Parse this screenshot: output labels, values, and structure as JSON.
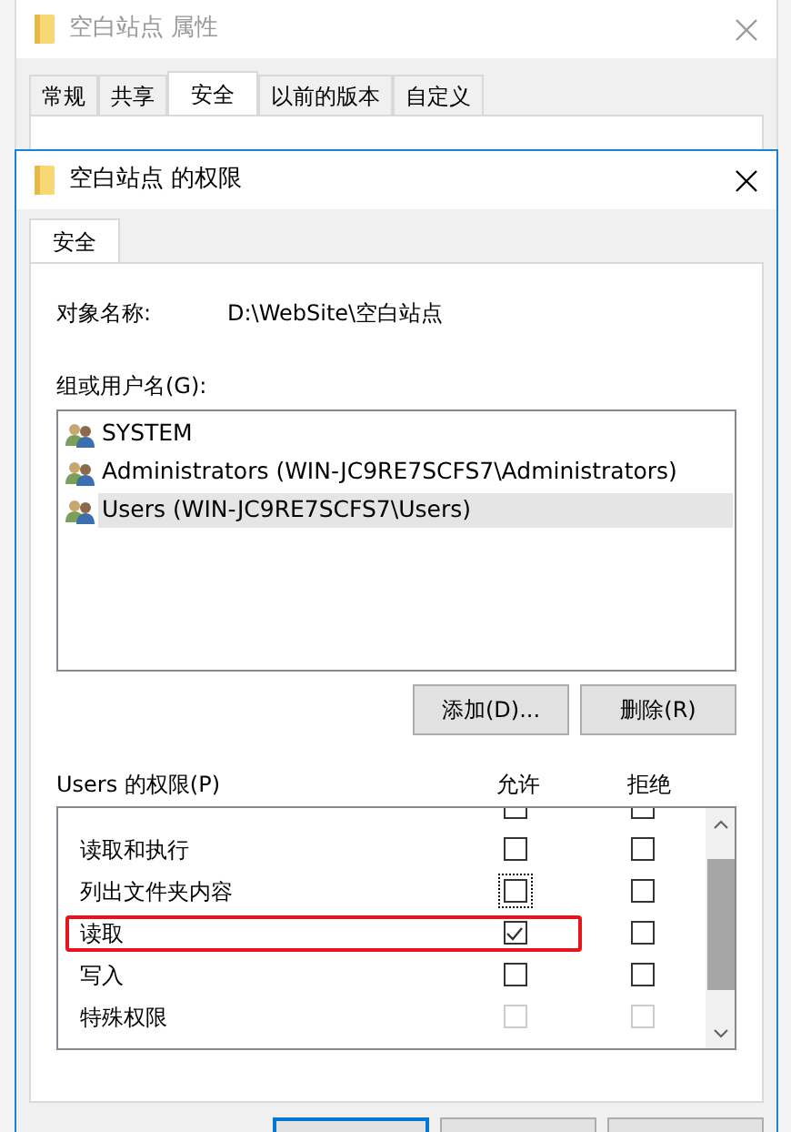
{
  "properties_window": {
    "title": "空白站点 属性",
    "tabs": [
      {
        "label": "常规",
        "selected": false
      },
      {
        "label": "共享",
        "selected": false
      },
      {
        "label": "安全",
        "selected": true
      },
      {
        "label": "以前的版本",
        "selected": false
      },
      {
        "label": "自定义",
        "selected": false
      }
    ]
  },
  "dialog": {
    "title": "空白站点 的权限",
    "tabs": [
      {
        "label": "安全",
        "selected": true
      }
    ],
    "object_label": "对象名称:",
    "object_value": "D:\\WebSite\\空白站点",
    "users_label": "组或用户名(G):",
    "users": [
      {
        "name": "SYSTEM",
        "selected": false
      },
      {
        "name": "Administrators (WIN-JC9RE7SCFS7\\Administrators)",
        "selected": false
      },
      {
        "name": "Users (WIN-JC9RE7SCFS7\\Users)",
        "selected": true
      }
    ],
    "buttons": [
      "添加(D)...",
      "删除(R)"
    ],
    "permissions_label": "Users 的权限(P)",
    "allow_header": "允许",
    "deny_header": "拒绝",
    "permissions": [
      {
        "kind": "cut"
      },
      {
        "kind": "row",
        "name": "读取和执行",
        "allow": false,
        "deny": false,
        "disabled": false,
        "focused": false,
        "highlighted": false
      },
      {
        "kind": "row",
        "name": "列出文件夹内容",
        "allow": false,
        "deny": false,
        "disabled": false,
        "focused": true,
        "highlighted": false
      },
      {
        "kind": "row",
        "name": "读取",
        "allow": true,
        "deny": false,
        "disabled": false,
        "focused": false,
        "highlighted": true
      },
      {
        "kind": "row",
        "name": "写入",
        "allow": false,
        "deny": false,
        "disabled": false,
        "focused": false,
        "highlighted": false
      },
      {
        "kind": "row",
        "name": "特殊权限",
        "allow": false,
        "deny": false,
        "disabled": true,
        "focused": false,
        "highlighted": false
      }
    ],
    "footer_buttons": [
      {
        "default": true
      },
      {
        "default": false
      },
      {
        "default": false
      }
    ]
  }
}
